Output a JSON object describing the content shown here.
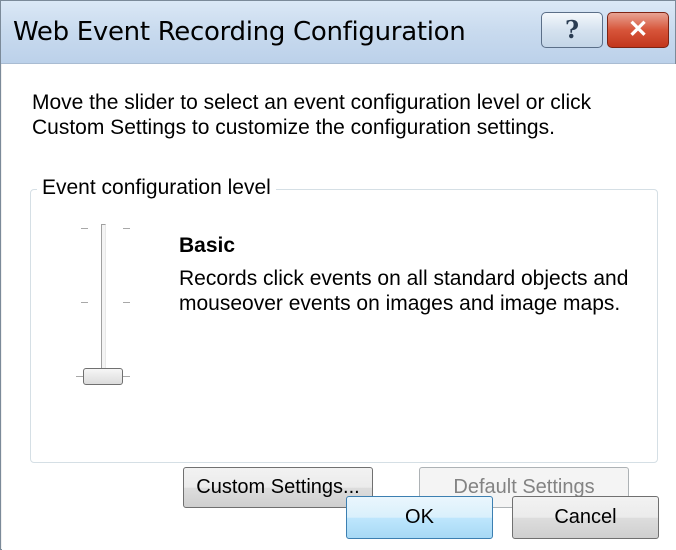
{
  "window": {
    "title": "Web Event Recording Configuration",
    "help_glyph": "?",
    "close_glyph": "✕"
  },
  "intro_text": "Move the slider to select an event configuration level or click Custom Settings to customize the configuration settings.",
  "group": {
    "label": "Event configuration level",
    "slider": {
      "levels": 3,
      "selected_level_index": 0,
      "selected_level": "Basic"
    },
    "level_name": "Basic",
    "level_description": "Records click events on all standard objects and mouseover events on images and image maps.",
    "custom_settings_label": "Custom Settings...",
    "default_settings_label": "Default Settings"
  },
  "footer": {
    "ok_label": "OK",
    "cancel_label": "Cancel"
  }
}
